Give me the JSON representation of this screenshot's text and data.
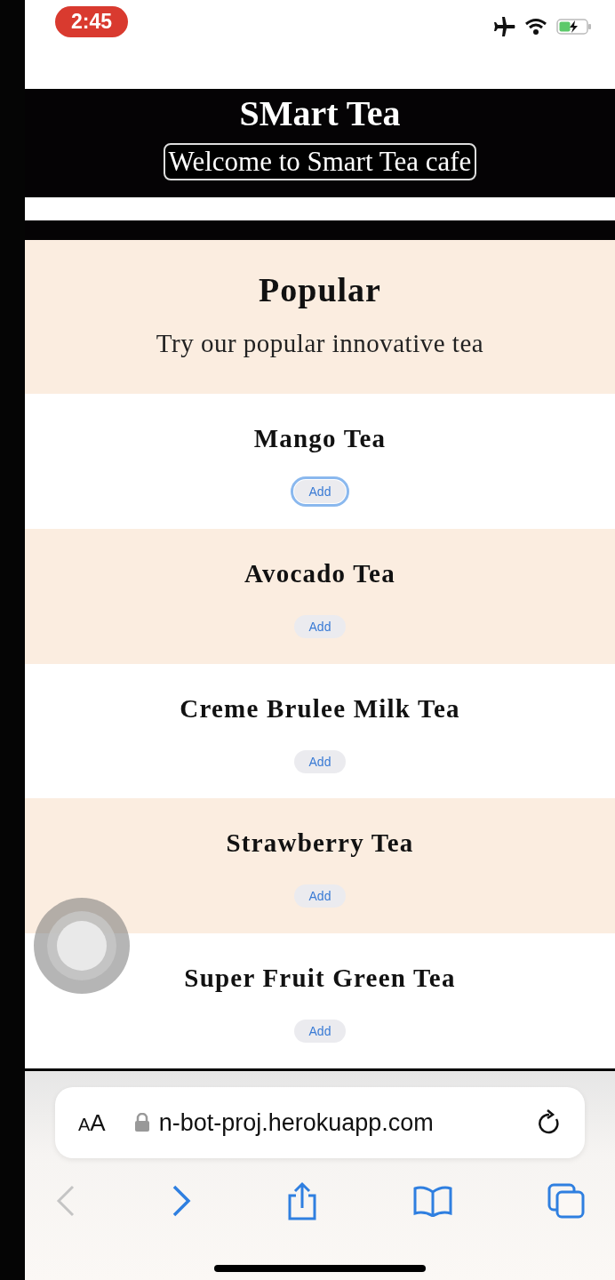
{
  "status_bar": {
    "time": "2:45",
    "airplane_mode": true
  },
  "header": {
    "title": "SMart Tea",
    "welcome": "Welcome to Smart Tea cafe"
  },
  "popular": {
    "heading": "Popular",
    "subtitle": "Try our popular innovative tea"
  },
  "items": [
    {
      "name": "Mango Tea",
      "button": "Add",
      "focused": true
    },
    {
      "name": "Avocado Tea",
      "button": "Add",
      "focused": false
    },
    {
      "name": "Creme Brulee Milk Tea",
      "button": "Add",
      "focused": false
    },
    {
      "name": "Strawberry Tea",
      "button": "Add",
      "focused": false
    },
    {
      "name": "Super Fruit Green Tea",
      "button": "Add",
      "focused": false
    }
  ],
  "browser": {
    "text_size_label": "AA",
    "url": "n-bot-proj.herokuapp.com",
    "back_disabled": true,
    "forward_disabled": false
  }
}
